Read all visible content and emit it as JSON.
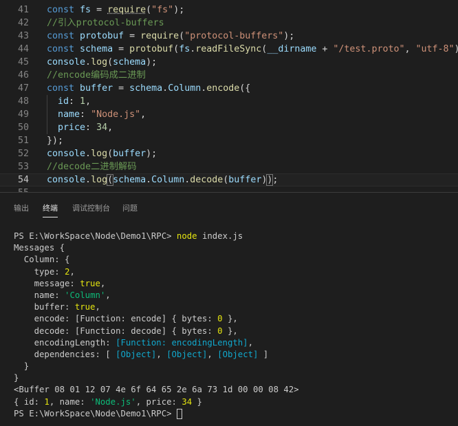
{
  "editor": {
    "lines": [
      {
        "no": "41",
        "tokens": [
          [
            "k",
            "const "
          ],
          [
            "v",
            "fs"
          ],
          [
            "p",
            " = "
          ],
          [
            "fsq",
            "require"
          ],
          [
            "p",
            "("
          ],
          [
            "s",
            "\"fs\""
          ],
          [
            "p",
            ");"
          ]
        ]
      },
      {
        "no": "42",
        "tokens": [
          [
            "c",
            "//引入protocol-buffers"
          ]
        ]
      },
      {
        "no": "43",
        "tokens": [
          [
            "k",
            "const "
          ],
          [
            "v",
            "protobuf"
          ],
          [
            "p",
            " = "
          ],
          [
            "f",
            "require"
          ],
          [
            "p",
            "("
          ],
          [
            "s",
            "\"protocol-buffers\""
          ],
          [
            "p",
            ");"
          ]
        ]
      },
      {
        "no": "44",
        "tokens": [
          [
            "k",
            "const "
          ],
          [
            "v",
            "schema"
          ],
          [
            "p",
            " = "
          ],
          [
            "f",
            "protobuf"
          ],
          [
            "p",
            "("
          ],
          [
            "v",
            "fs"
          ],
          [
            "p",
            "."
          ],
          [
            "f",
            "readFileSync"
          ],
          [
            "p",
            "("
          ],
          [
            "v",
            "__dirname"
          ],
          [
            "p",
            " + "
          ],
          [
            "s",
            "\"/test.proto\""
          ],
          [
            "p",
            ", "
          ],
          [
            "s",
            "\"utf-8\""
          ],
          [
            "p",
            "));"
          ]
        ]
      },
      {
        "no": "45",
        "tokens": [
          [
            "v",
            "console"
          ],
          [
            "p",
            "."
          ],
          [
            "f",
            "log"
          ],
          [
            "p",
            "("
          ],
          [
            "v",
            "schema"
          ],
          [
            "p",
            ");"
          ]
        ]
      },
      {
        "no": "46",
        "tokens": [
          [
            "c",
            "//encode编码成二进制"
          ]
        ]
      },
      {
        "no": "47",
        "tokens": [
          [
            "k",
            "const "
          ],
          [
            "v",
            "buffer"
          ],
          [
            "p",
            " = "
          ],
          [
            "v",
            "schema"
          ],
          [
            "p",
            "."
          ],
          [
            "v",
            "Column"
          ],
          [
            "p",
            "."
          ],
          [
            "f",
            "encode"
          ],
          [
            "p",
            "({"
          ]
        ]
      },
      {
        "no": "48",
        "tokens": [
          [
            "p",
            "  "
          ],
          [
            "v",
            "id"
          ],
          [
            "p",
            ": "
          ],
          [
            "n",
            "1"
          ],
          [
            "p",
            ","
          ]
        ]
      },
      {
        "no": "49",
        "tokens": [
          [
            "p",
            "  "
          ],
          [
            "v",
            "name"
          ],
          [
            "p",
            ": "
          ],
          [
            "s",
            "\"Node.js\""
          ],
          [
            "p",
            ","
          ]
        ]
      },
      {
        "no": "50",
        "tokens": [
          [
            "p",
            "  "
          ],
          [
            "v",
            "price"
          ],
          [
            "p",
            ": "
          ],
          [
            "n",
            "34"
          ],
          [
            "p",
            ","
          ]
        ]
      },
      {
        "no": "51",
        "tokens": [
          [
            "p",
            "});"
          ]
        ]
      },
      {
        "no": "52",
        "tokens": [
          [
            "v",
            "console"
          ],
          [
            "p",
            "."
          ],
          [
            "f",
            "log"
          ],
          [
            "p",
            "("
          ],
          [
            "v",
            "buffer"
          ],
          [
            "p",
            ");"
          ]
        ]
      },
      {
        "no": "53",
        "tokens": [
          [
            "c",
            "//decode二进制解码"
          ]
        ]
      },
      {
        "no": "54",
        "tokens": [
          [
            "v",
            "console"
          ],
          [
            "p",
            "."
          ],
          [
            "f",
            "log"
          ],
          [
            "b",
            "("
          ],
          [
            "v",
            "schema"
          ],
          [
            "p",
            "."
          ],
          [
            "v",
            "Column"
          ],
          [
            "p",
            "."
          ],
          [
            "f",
            "decode"
          ],
          [
            "p",
            "("
          ],
          [
            "v",
            "buffer"
          ],
          [
            "p",
            ")"
          ],
          [
            "b",
            ")"
          ],
          [
            "p",
            ";"
          ]
        ]
      },
      {
        "no": "55",
        "tokens": []
      }
    ],
    "active_line": "54"
  },
  "panel": {
    "tabs": [
      {
        "label": "输出",
        "active": false
      },
      {
        "label": "终端",
        "active": true
      },
      {
        "label": "调试控制台",
        "active": false
      },
      {
        "label": "问题",
        "active": false
      }
    ]
  },
  "terminal": {
    "lines": [
      [
        [
          "p",
          "PS E:\\WorkSpace\\Node\\Demo1\\RPC> "
        ],
        [
          "y",
          "node"
        ],
        [
          "p",
          " index.js"
        ]
      ],
      [
        [
          "p",
          "Messages {"
        ]
      ],
      [
        [
          "p",
          "  Column: {"
        ]
      ],
      [
        [
          "p",
          "    type: "
        ],
        [
          "y",
          "2"
        ],
        [
          "p",
          ","
        ]
      ],
      [
        [
          "p",
          "    message: "
        ],
        [
          "y",
          "true"
        ],
        [
          "p",
          ","
        ]
      ],
      [
        [
          "p",
          "    name: "
        ],
        [
          "g",
          "'Column'"
        ],
        [
          "p",
          ","
        ]
      ],
      [
        [
          "p",
          "    buffer: "
        ],
        [
          "y",
          "true"
        ],
        [
          "p",
          ","
        ]
      ],
      [
        [
          "p",
          "    encode: [Function: encode] { bytes: "
        ],
        [
          "y",
          "0"
        ],
        [
          "p",
          " },"
        ]
      ],
      [
        [
          "p",
          "    decode: [Function: decode] { bytes: "
        ],
        [
          "y",
          "0"
        ],
        [
          "p",
          " },"
        ]
      ],
      [
        [
          "p",
          "    encodingLength: "
        ],
        [
          "c",
          "[Function: encodingLength]"
        ],
        [
          "p",
          ","
        ]
      ],
      [
        [
          "p",
          "    dependencies: [ "
        ],
        [
          "c",
          "[Object]"
        ],
        [
          "p",
          ", "
        ],
        [
          "c",
          "[Object]"
        ],
        [
          "p",
          ", "
        ],
        [
          "c",
          "[Object]"
        ],
        [
          "p",
          " ]"
        ]
      ],
      [
        [
          "p",
          "  }"
        ]
      ],
      [
        [
          "p",
          "}"
        ]
      ],
      [
        [
          "p",
          "<Buffer 08 01 12 07 4e 6f 64 65 2e 6a 73 1d 00 00 08 42>"
        ]
      ],
      [
        [
          "p",
          "{ id: "
        ],
        [
          "y",
          "1"
        ],
        [
          "p",
          ", name: "
        ],
        [
          "g",
          "'Node.js'"
        ],
        [
          "p",
          ", price: "
        ],
        [
          "y",
          "34"
        ],
        [
          "p",
          " }"
        ]
      ],
      [
        [
          "p",
          "PS E:\\WorkSpace\\Node\\Demo1\\RPC> "
        ],
        [
          "cursor",
          ""
        ]
      ]
    ]
  }
}
